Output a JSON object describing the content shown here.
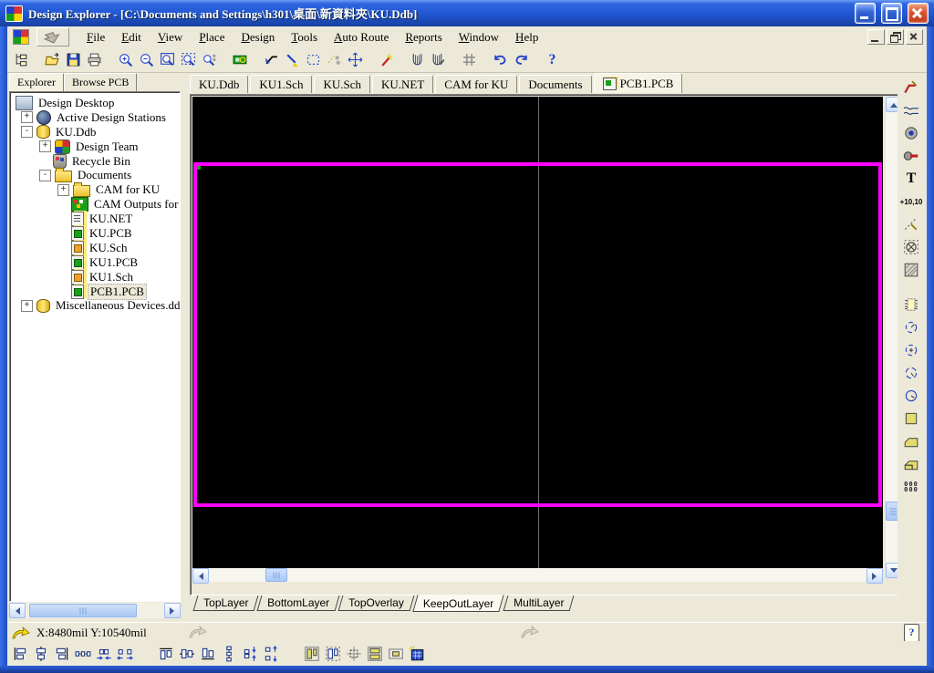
{
  "titlebar": {
    "title": "Design Explorer - [C:\\Documents and Settings\\h301\\桌面\\新資料夾\\KU.Ddb]"
  },
  "menu": {
    "items": [
      "File",
      "Edit",
      "View",
      "Place",
      "Design",
      "Tools",
      "Auto Route",
      "Reports",
      "Window",
      "Help"
    ]
  },
  "toolbar": {
    "help_glyph": "?",
    "icons": [
      "explorer-toggle",
      "open-document",
      "save",
      "print",
      "zoom-in",
      "zoom-out",
      "zoom-area",
      "zoom-document",
      "zoom-selection",
      "browse-pcb",
      "cutter",
      "highlight-net",
      "select-area",
      "deselect",
      "move",
      "wand",
      "mesh-shield",
      "mesh-shield-pen",
      "snap-grid",
      "undo",
      "redo",
      "help"
    ]
  },
  "explorer_panel": {
    "tabs": [
      "Explorer",
      "Browse PCB"
    ],
    "tree": {
      "items": [
        {
          "label": "Design Desktop",
          "toggle": ""
        },
        {
          "label": "Active Design Stations",
          "toggle": "+"
        },
        {
          "label": "KU.Ddb",
          "toggle": "-"
        },
        {
          "label": "Design Team",
          "toggle": "+"
        },
        {
          "label": "Recycle Bin",
          "toggle": ""
        },
        {
          "label": "Documents",
          "toggle": "-"
        },
        {
          "label": "CAM for KU",
          "toggle": "+"
        },
        {
          "label": "CAM Outputs for KU",
          "toggle": ""
        },
        {
          "label": "KU.NET",
          "toggle": ""
        },
        {
          "label": "KU.PCB",
          "toggle": ""
        },
        {
          "label": "KU.Sch",
          "toggle": ""
        },
        {
          "label": "KU1.PCB",
          "toggle": ""
        },
        {
          "label": "KU1.Sch",
          "toggle": ""
        },
        {
          "label": "PCB1.PCB",
          "toggle": "",
          "selected": true
        },
        {
          "label": "Miscellaneous Devices.ddb",
          "toggle": "+"
        }
      ]
    }
  },
  "document_tabs": {
    "active": "PCB1.PCB",
    "items": [
      "KU.Ddb",
      "KU1.Sch",
      "KU.Sch",
      "KU.NET",
      "CAM for KU",
      "Documents",
      "PCB1.PCB"
    ]
  },
  "layer_tabs": {
    "active": "KeepOutLayer",
    "items": [
      "TopLayer",
      "BottomLayer",
      "TopOverlay",
      "KeepOutLayer",
      "MultiLayer"
    ]
  },
  "placement_toolbar": {
    "text_tool_label": "T",
    "coordinate_tool_label": "+10,10",
    "paste_array_label": "000",
    "icons": [
      "interactive-routing",
      "arc-track",
      "via",
      "pad",
      "string",
      "coordinate",
      "dimension",
      "crossed-circle",
      "hatched-fill",
      "component",
      "arc-edge",
      "arc-center",
      "arc-angle",
      "full-circle",
      "fill",
      "polygon-plane",
      "split-plane",
      "paste-array"
    ]
  },
  "alignment_toolbar": {
    "icons": [
      "align-left",
      "align-center-horizontal",
      "align-right",
      "space-equal-horizontal",
      "decrease-horizontal-spacing",
      "increase-horizontal-spacing",
      "align-top",
      "align-middle",
      "align-bottom",
      "space-equal-vertical",
      "decrease-vertical-spacing",
      "increase-vertical-spacing",
      "arrange-in-room",
      "arrange-in-region",
      "move-to-grid",
      "component-placement",
      "shove-component",
      "paste-array-special"
    ]
  },
  "status_bar": {
    "coordinates": "X:8480mil Y:10540mil",
    "help_glyph": "?"
  },
  "colors": {
    "board_outline": "#ff00ff",
    "canvas_background": "#000000",
    "titlebar_blue": "#2156d2",
    "window_chrome": "#ece9d8",
    "grid_line": "#6e6e6e"
  }
}
